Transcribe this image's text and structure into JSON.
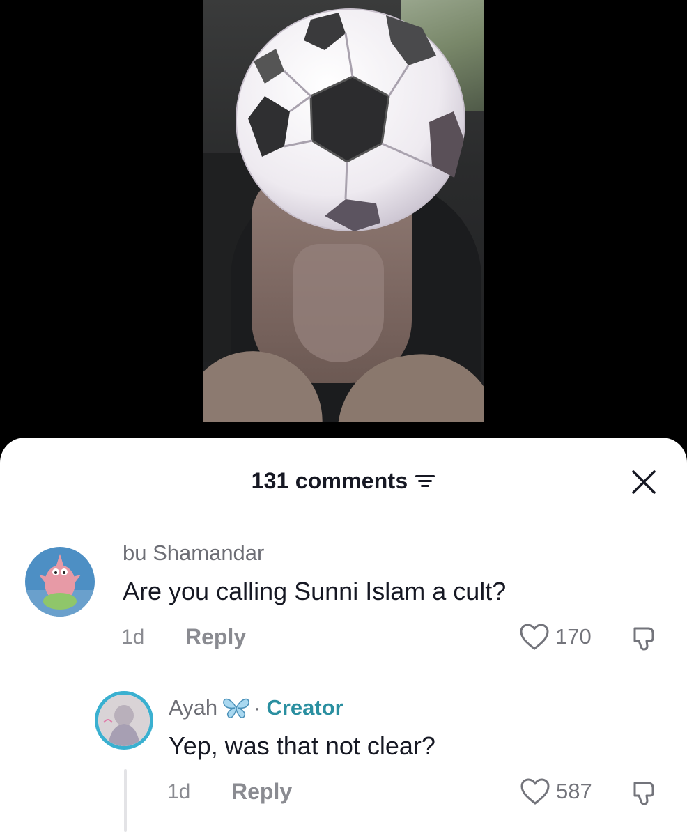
{
  "comments_header": {
    "count_label": "131 comments"
  },
  "comments": [
    {
      "username": "bu Shamandar",
      "text": "Are you calling Sunni Islam a cult?",
      "time": "1d",
      "reply_label": "Reply",
      "likes": "170"
    },
    {
      "username": "Ayah",
      "separator": "·",
      "creator_label": "Creator",
      "text": "Yep, was that not clear?",
      "time": "1d",
      "reply_label": "Reply",
      "likes": "587"
    }
  ],
  "colors": {
    "creator_accent": "#2a8fa0",
    "creator_ring": "#3ab0d0",
    "sheet_bg": "#ffffff",
    "primary_text": "#161823",
    "secondary_text": "#8a8b91"
  },
  "icons": [
    "sort-icon",
    "close-icon",
    "heart-icon",
    "dislike-icon",
    "butterfly-icon",
    "soccer-ball-emoji"
  ]
}
